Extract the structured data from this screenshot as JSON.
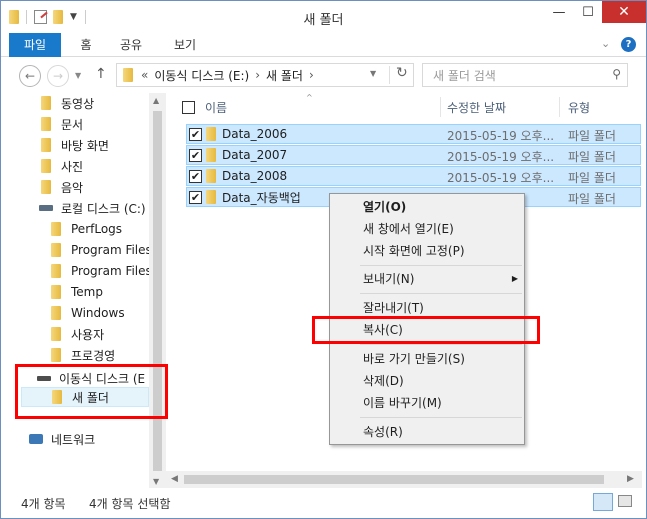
{
  "window": {
    "title": "새 폴더"
  },
  "ribbon": {
    "tabs": [
      "파일",
      "홈",
      "공유",
      "보기"
    ]
  },
  "address": {
    "breadcrumb": [
      "«",
      "이동식 디스크 (E:)",
      "›",
      "새 폴더",
      "›"
    ],
    "search_placeholder": "새 폴더 검색"
  },
  "navpane": {
    "items": [
      {
        "label": "동영상",
        "icon": "video-folder-icon"
      },
      {
        "label": "문서",
        "icon": "documents-folder-icon"
      },
      {
        "label": "바탕 화면",
        "icon": "desktop-folder-icon"
      },
      {
        "label": "사진",
        "icon": "pictures-folder-icon"
      },
      {
        "label": "음악",
        "icon": "music-folder-icon"
      },
      {
        "label": "로컬 디스크 (C:)",
        "icon": "local-disk-icon"
      },
      {
        "label": "PerfLogs",
        "icon": "folder-icon"
      },
      {
        "label": "Program Files",
        "icon": "folder-icon"
      },
      {
        "label": "Program Files (",
        "icon": "folder-icon"
      },
      {
        "label": "Temp",
        "icon": "folder-icon"
      },
      {
        "label": "Windows",
        "icon": "folder-icon"
      },
      {
        "label": "사용자",
        "icon": "folder-icon"
      },
      {
        "label": "프로경영",
        "icon": "folder-icon"
      },
      {
        "label": "이동식 디스크 (E",
        "icon": "removable-disk-icon"
      },
      {
        "label": "새 폴더",
        "icon": "folder-icon"
      },
      {
        "label": "네트워크",
        "icon": "network-icon"
      }
    ]
  },
  "columns": {
    "name": "이름",
    "modified": "수정한 날짜",
    "type": "유형"
  },
  "files": [
    {
      "name": "Data_2006",
      "modified": "2015-05-19 오후...",
      "type": "파일 폴더"
    },
    {
      "name": "Data_2007",
      "modified": "2015-05-19 오후...",
      "type": "파일 폴더"
    },
    {
      "name": "Data_2008",
      "modified": "2015-05-19 오후...",
      "type": "파일 폴더"
    },
    {
      "name": "Data_자동백업",
      "modified": "",
      "type": "파일 폴더"
    }
  ],
  "status": {
    "count": "4개 항목",
    "selected": "4개 항목 선택함"
  },
  "context_menu": {
    "open": "열기(O)",
    "open_new": "새 창에서 열기(E)",
    "pin_start": "시작 화면에 고정(P)",
    "send_to": "보내기(N)",
    "cut": "잘라내기(T)",
    "copy": "복사(C)",
    "shortcut": "바로 가기 만들기(S)",
    "delete": "삭제(D)",
    "rename": "이름 바꾸기(M)",
    "properties": "속성(R)"
  },
  "colors": {
    "accent": "#1979ca",
    "selection": "#cce8ff",
    "highlight": "#ff0000"
  }
}
